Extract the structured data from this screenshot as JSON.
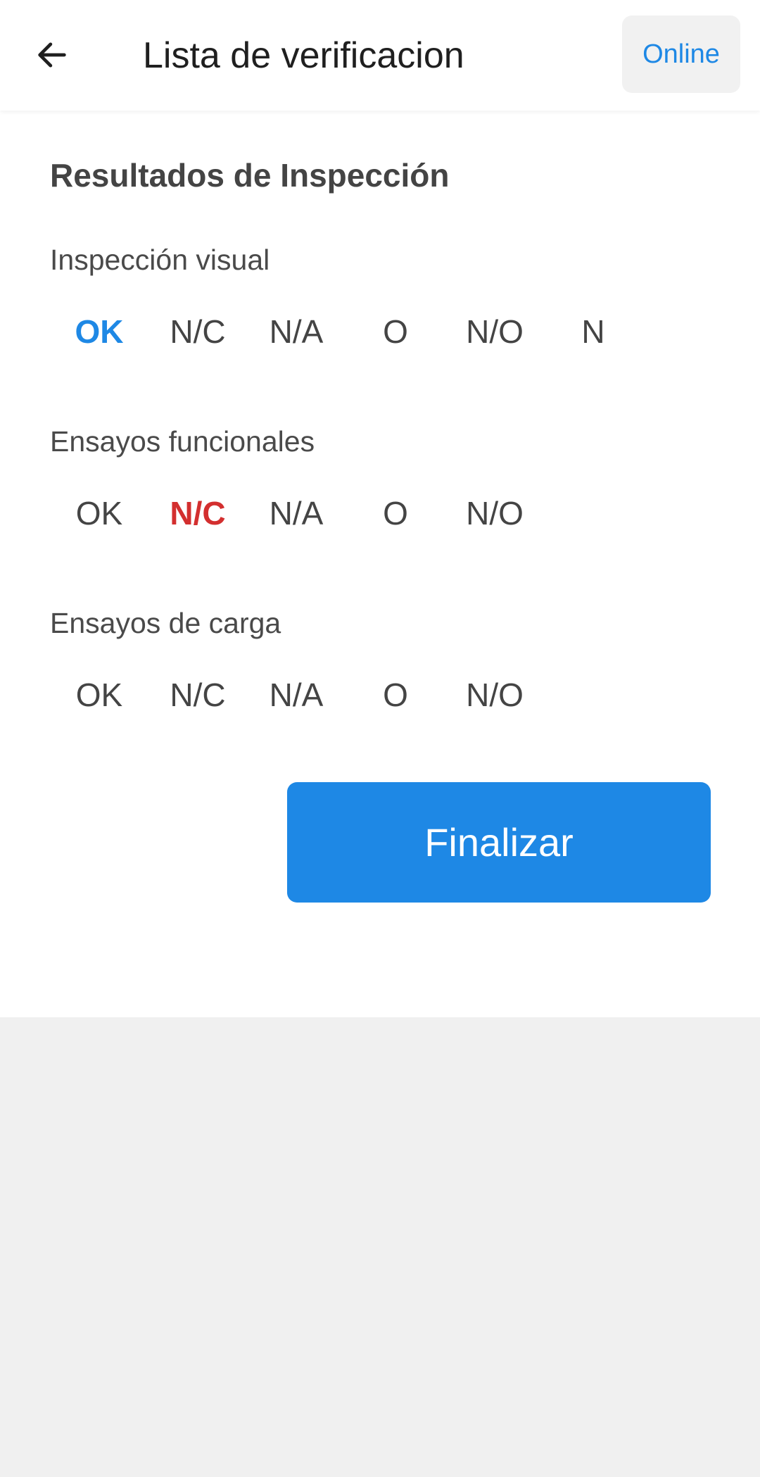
{
  "header": {
    "title": "Lista de verificacion",
    "back_icon": "arrow-left-icon",
    "online_label": "Online"
  },
  "main": {
    "section_title": "Resultados de Inspección",
    "groups": [
      {
        "label": "Inspección visual",
        "options": [
          "OK",
          "N/C",
          "N/A",
          "O",
          "N/O",
          "N"
        ],
        "selected": "OK"
      },
      {
        "label": "Ensayos funcionales",
        "options": [
          "OK",
          "N/C",
          "N/A",
          "O",
          "N/O"
        ],
        "selected": "N/C"
      },
      {
        "label": "Ensayos de carga",
        "options": [
          "OK",
          "N/C",
          "N/A",
          "O",
          "N/O"
        ],
        "selected": null
      }
    ],
    "finalize_label": "Finalizar"
  },
  "colors": {
    "accent": "#1e88e5",
    "selected_ok": "#1e88e5",
    "selected_nc": "#d32f2f",
    "text": "#444444",
    "background": "#f0f0f0"
  }
}
